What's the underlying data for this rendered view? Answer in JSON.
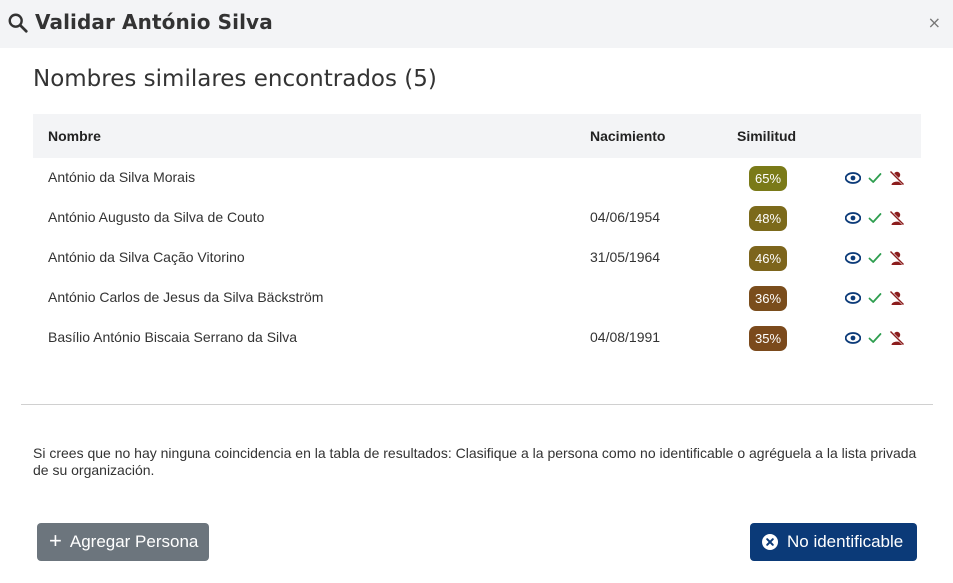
{
  "header": {
    "title": "Validar António Silva",
    "close_label": "×"
  },
  "subtitle": "Nombres similares encontrados (5)",
  "table": {
    "columns": {
      "name": "Nombre",
      "birth": "Nacimiento",
      "similarity": "Similitud"
    },
    "rows": [
      {
        "name": "António da Silva Morais",
        "birth": "",
        "similarity": "65%",
        "color": "#7a7a18"
      },
      {
        "name": "António Augusto da Silva de Couto",
        "birth": "04/06/1954",
        "similarity": "48%",
        "color": "#7c6a1b"
      },
      {
        "name": "António da Silva Cação Vitorino",
        "birth": "31/05/1964",
        "similarity": "46%",
        "color": "#7d651c"
      },
      {
        "name": "António Carlos de Jesus da Silva Bäckström",
        "birth": "",
        "similarity": "36%",
        "color": "#7a4d1c"
      },
      {
        "name": "Basílio António Biscaia Serrano da Silva",
        "birth": "04/08/1991",
        "similarity": "35%",
        "color": "#7b4a1c"
      }
    ]
  },
  "note": "Si crees que no hay ninguna coincidencia en la tabla de resultados: Clasifique a la persona como no identificable o agréguela a la lista privada de su organización.",
  "buttons": {
    "add_label": "Agregar Persona",
    "noid_label": "No identificable"
  },
  "colors": {
    "primary": "#0b3a78",
    "secondary": "#6c757d",
    "view_icon": "#0b3a78",
    "accept_icon": "#2e9e4f",
    "reject_icon": "#8b1c1c"
  }
}
